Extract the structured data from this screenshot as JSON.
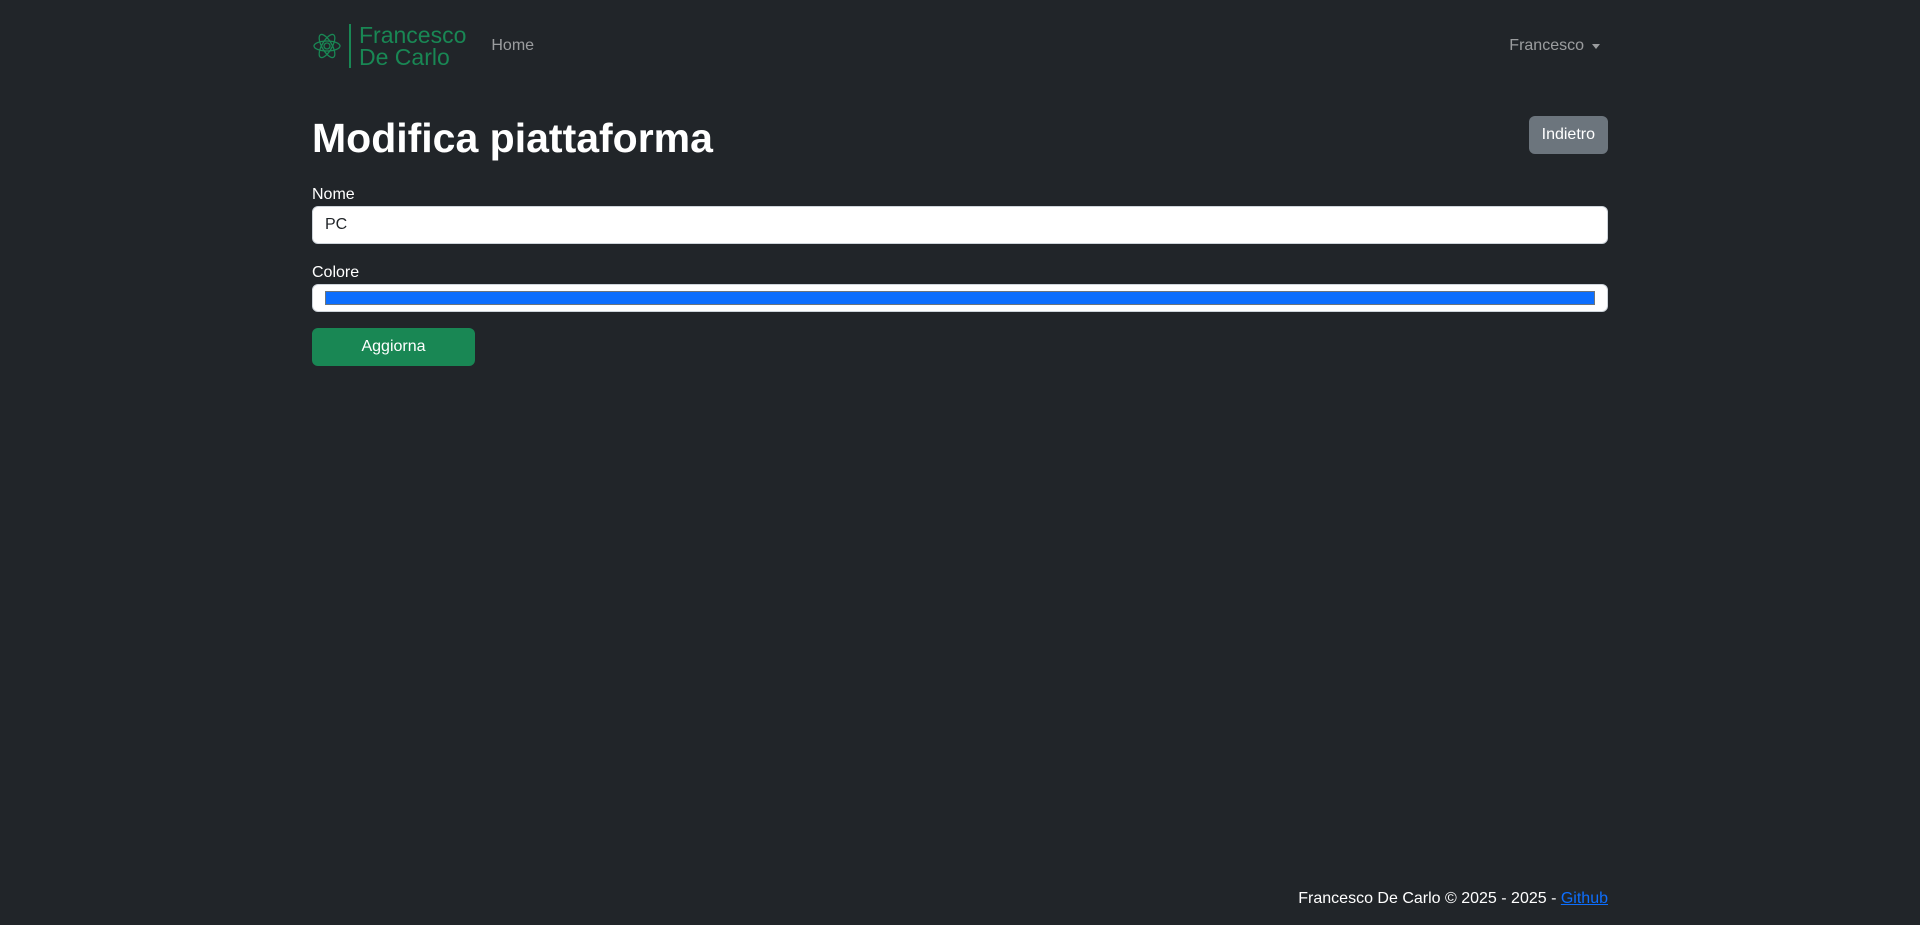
{
  "navbar": {
    "brand_line1": "Francesco",
    "brand_line2": "De Carlo",
    "brand_color": "#198754",
    "brand_icon": "atom-flower-logo-icon",
    "home_label": "Home",
    "user_label": "Francesco"
  },
  "header": {
    "title": "Modifica piattaforma",
    "back_label": "Indietro"
  },
  "form": {
    "name_label": "Nome",
    "name_value": "PC",
    "color_label": "Colore",
    "color_value": "#0d6efd",
    "submit_label": "Aggiorna"
  },
  "footer": {
    "text": "Francesco De Carlo © 2025 - 2025 - ",
    "link_label": "Github"
  },
  "colors": {
    "background": "#212529",
    "success": "#198754",
    "secondary": "#6c757d",
    "link": "#0d6efd"
  }
}
